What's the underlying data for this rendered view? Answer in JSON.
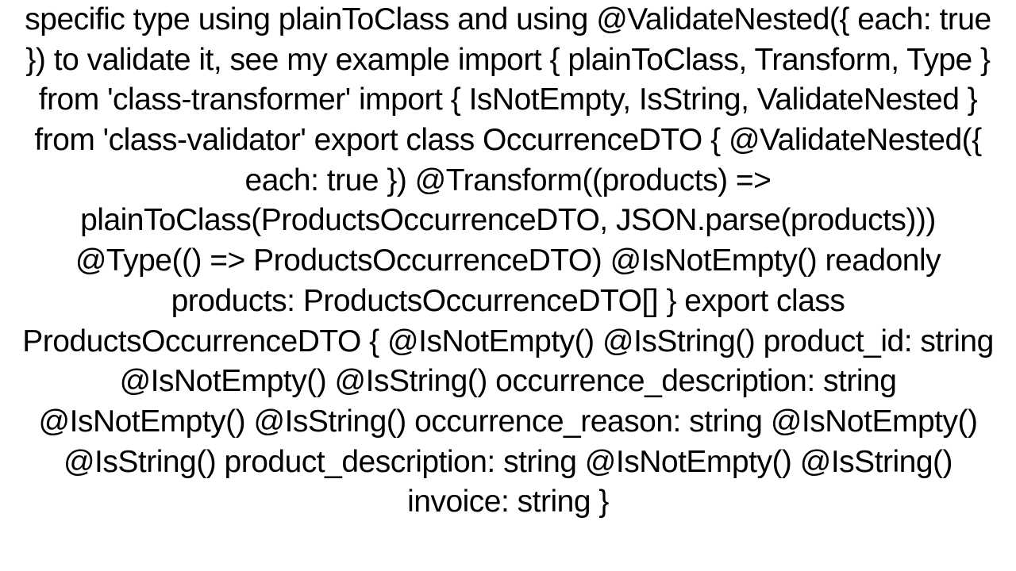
{
  "document": {
    "text": "specific type using plainToClass and using @ValidateNested({ each: true }) to validate it, see my example  import { plainToClass, Transform, Type } from 'class-transformer'  import { IsNotEmpty, IsString, ValidateNested } from 'class-validator'  export class OccurrenceDTO {     @ValidateNested({ each: true })     @Transform((products) => plainToClass(ProductsOccurrenceDTO, JSON.parse(products)))     @Type(() => ProductsOccurrenceDTO)     @IsNotEmpty()     readonly products: ProductsOccurrenceDTO[] }  export class ProductsOccurrenceDTO {     @IsNotEmpty()     @IsString()     product_id: string     @IsNotEmpty()     @IsString()     occurrence_description: string     @IsNotEmpty()     @IsString()     occurrence_reason: string     @IsNotEmpty()     @IsString()     product_description: string     @IsNotEmpty()     @IsString()     invoice: string }"
  }
}
